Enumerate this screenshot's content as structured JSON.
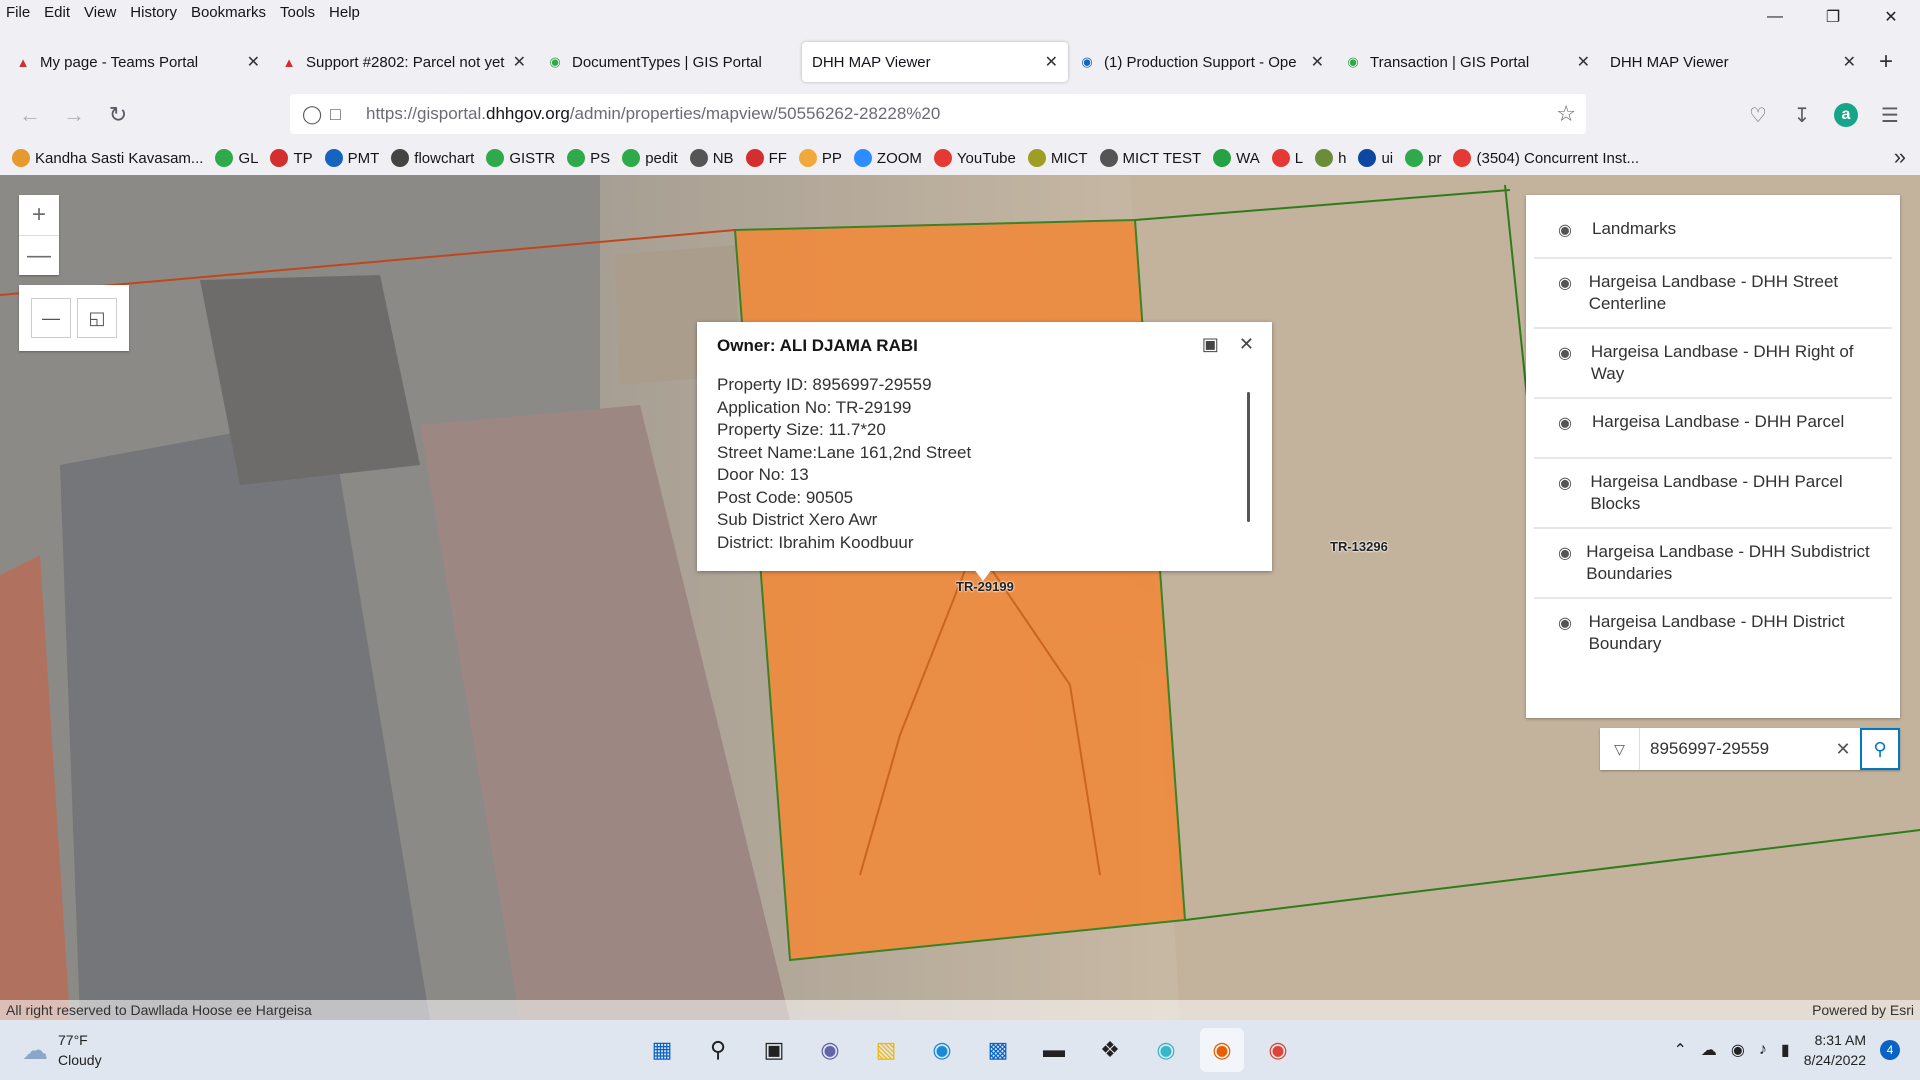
{
  "menu": [
    "File",
    "Edit",
    "View",
    "History",
    "Bookmarks",
    "Tools",
    "Help"
  ],
  "tabs": [
    {
      "title": "My page - Teams Portal",
      "icon": "teams-icon",
      "color": "#d32f2f"
    },
    {
      "title": "Support #2802: Parcel not yet",
      "icon": "redmine-icon",
      "color": "#d32f2f"
    },
    {
      "title": "DocumentTypes | GIS Portal",
      "icon": "gis-portal-icon",
      "color": "#2eaa4a"
    },
    {
      "title": "DHH MAP Viewer",
      "icon": "",
      "color": ""
    },
    {
      "title": "(1) Production Support - Ope",
      "icon": "support-icon",
      "color": "#1565c0"
    },
    {
      "title": "Transaction | GIS Portal",
      "icon": "gis-portal-icon",
      "color": "#2eaa4a"
    },
    {
      "title": "DHH MAP Viewer",
      "icon": "",
      "color": ""
    }
  ],
  "url": {
    "prefix": "https://gisportal.",
    "domain": "dhhgov.org",
    "path": "/admin/properties/mapview/50556262-28228%20"
  },
  "bookmarks": [
    {
      "label": "Kandha Sasti Kavasam...",
      "color": "#e69a2e"
    },
    {
      "label": "GL",
      "color": "#2eaa4a"
    },
    {
      "label": "TP",
      "color": "#d32f2f"
    },
    {
      "label": "PMT",
      "color": "#1565c0"
    },
    {
      "label": "flowchart",
      "color": "#444444"
    },
    {
      "label": "GISTR",
      "color": "#2eaa4a"
    },
    {
      "label": "PS",
      "color": "#2eaa4a"
    },
    {
      "label": "pedit",
      "color": "#2eaa4a"
    },
    {
      "label": "NB",
      "color": "#555555"
    },
    {
      "label": "FF",
      "color": "#d32f2f"
    },
    {
      "label": "PP",
      "color": "#f2a93b"
    },
    {
      "label": "ZOOM",
      "color": "#2d8cff"
    },
    {
      "label": "YouTube",
      "color": "#e53935"
    },
    {
      "label": "MICT",
      "color": "#9e9d24"
    },
    {
      "label": "MICT TEST",
      "color": "#555555"
    },
    {
      "label": "WA",
      "color": "#25a244"
    },
    {
      "label": "L",
      "color": "#e53935"
    },
    {
      "label": "h",
      "color": "#6d8c3a"
    },
    {
      "label": "ui",
      "color": "#0d47a1"
    },
    {
      "label": "pr",
      "color": "#2eaa4a"
    },
    {
      "label": "(3504) Concurrent Inst...",
      "color": "#e53935"
    }
  ],
  "popup": {
    "title": "Owner: ALI DJAMA RABI",
    "rows": [
      "Property ID: 8956997-29559",
      "Application No: TR-29199",
      "Property Size: 11.7*20",
      "Street Name:Lane 161,2nd Street",
      "Door No: 13",
      "Post Code: 90505",
      "Sub District Xero Awr",
      "District: Ibrahim Koodbuur"
    ]
  },
  "map_labels": {
    "parcel_a": "TR-29199",
    "parcel_b": "TR-13296"
  },
  "layers": [
    "Landmarks",
    "Hargeisa Landbase - DHH Street Centerline",
    "Hargeisa Landbase - DHH Right of Way",
    "Hargeisa Landbase - DHH Parcel",
    "Hargeisa Landbase - DHH Parcel Blocks",
    "Hargeisa Landbase - DHH Subdistrict Boundaries",
    "Hargeisa Landbase - DHH District Boundary"
  ],
  "search": {
    "value": "8956997-29559"
  },
  "attribution": {
    "left": "All right reserved to Dawllada Hoose ee Hargeisa",
    "right": "Powered by Esri"
  },
  "weather": {
    "temp": "77°F",
    "condition": "Cloudy"
  },
  "clock": {
    "time": "8:31 AM",
    "date": "8/24/2022"
  },
  "notifications": "4",
  "colors": {
    "parcel_highlight": "#f08a3c",
    "parcel_boundary": "#2e7d1a",
    "street_line": "#c0471b",
    "esri_blue": "#0079c1"
  }
}
